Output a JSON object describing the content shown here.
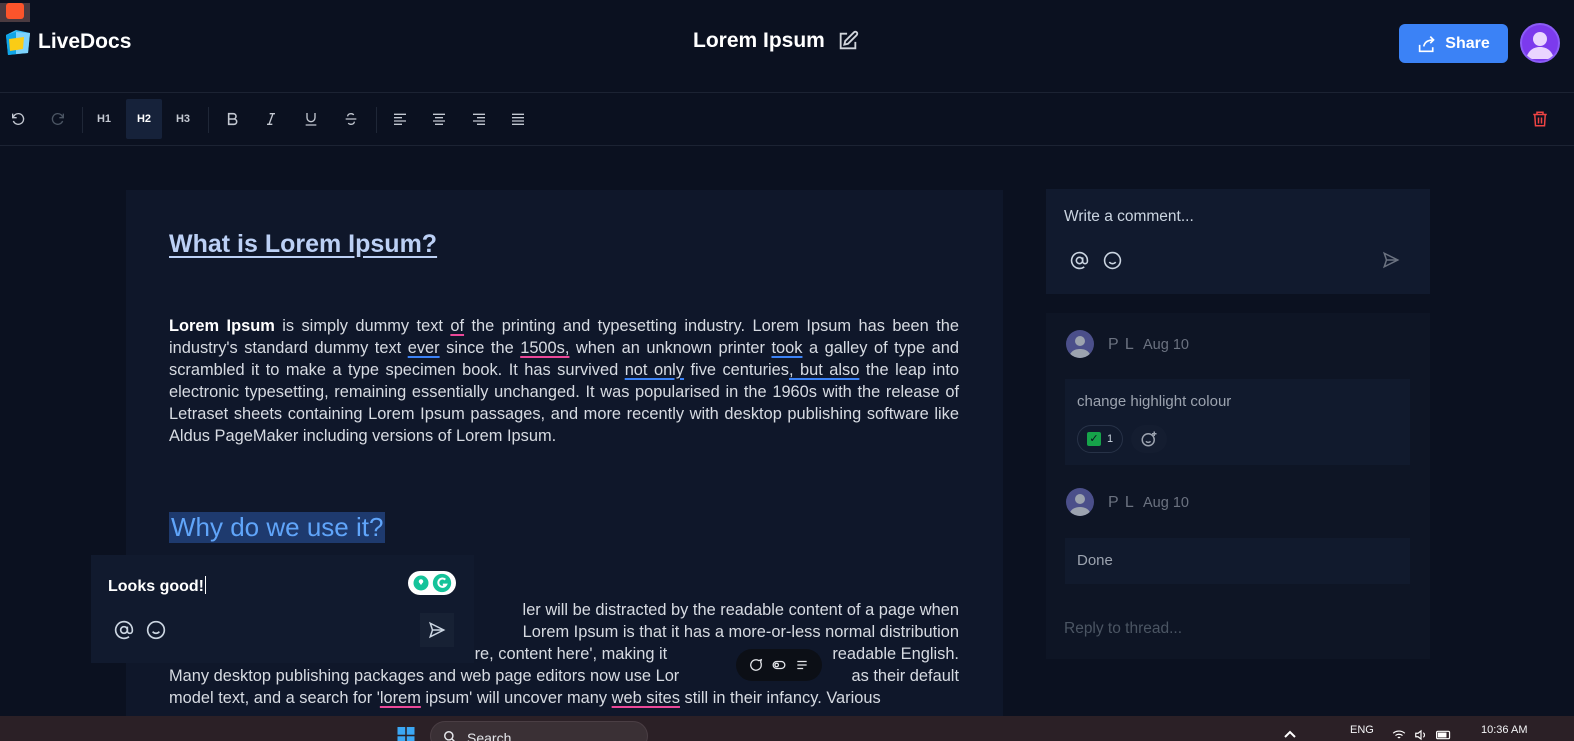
{
  "app": {
    "name": "LiveDocs"
  },
  "document": {
    "title": "Lorem Ipsum"
  },
  "header": {
    "share_label": "Share"
  },
  "toolbar": {
    "h1": "H1",
    "h2": "H2",
    "h3": "H3",
    "active_heading": "H2"
  },
  "content": {
    "heading1": "What is Lorem Ipsum?",
    "para1": [
      {
        "t": "Lorem Ipsum",
        "s": "bold"
      },
      {
        "t": " is simply dummy text ",
        "s": ""
      },
      {
        "t": "of",
        "s": "red"
      },
      {
        "t": " the printing and typesetting industry. Lorem Ipsum has been the industry's standard dummy text ",
        "s": ""
      },
      {
        "t": "ever",
        "s": "blue"
      },
      {
        "t": " since the ",
        "s": ""
      },
      {
        "t": "1500s,",
        "s": "red"
      },
      {
        "t": " when an unknown printer ",
        "s": ""
      },
      {
        "t": "took",
        "s": "blue"
      },
      {
        "t": " a galley of type and scrambled it to make a type specimen book. It has survived ",
        "s": ""
      },
      {
        "t": "not only",
        "s": "blue"
      },
      {
        "t": " five centuries",
        "s": ""
      },
      {
        "t": ", but also",
        "s": "blue"
      },
      {
        "t": " the leap into electronic typesetting, remaining essentially unchanged. It was popularised in the 1960s with the release of Letraset sheets containing Lorem Ipsum passages, and more recently with desktop publishing software like Aldus PageMaker including versions of Lorem Ipsum.",
        "s": ""
      }
    ],
    "heading2": "Why do we use it?",
    "para2": [
      {
        "t": "ler will be distracted by the readable content of a page when",
        "s": ""
      }
    ],
    "para2_line2": "Lorem Ipsum is that it has a more-or-less normal distribution",
    "para2_line3a": "ent here, content here', making it",
    "para2_line3b": "readable English.",
    "para2_line4a": "Many desktop publishing packages and web page editors now use Lor",
    "para2_line4b": "as their default",
    "para2_line5": [
      {
        "t": "model text, and a search for '",
        "s": ""
      },
      {
        "t": "lorem",
        "s": "red"
      },
      {
        "t": " ipsum' will uncover many ",
        "s": ""
      },
      {
        "t": "web sites",
        "s": "red"
      },
      {
        "t": " still in their infancy. Various",
        "s": ""
      }
    ]
  },
  "composer": {
    "value": "Looks good!"
  },
  "comments": {
    "new_placeholder": "Write a comment...",
    "thread": [
      {
        "author": "P L",
        "date": "Aug 10",
        "text": "change highlight colour",
        "reaction_count": "1"
      },
      {
        "author": "P L",
        "date": "Aug 10",
        "text": "Done"
      }
    ],
    "reply_placeholder": "Reply to thread..."
  },
  "taskbar": {
    "search_label": "Search",
    "lang": "ENG",
    "time": "10:36 AM"
  },
  "colors": {
    "accent": "#3b82f6",
    "background": "#0b1120",
    "delete": "#ef4444"
  }
}
